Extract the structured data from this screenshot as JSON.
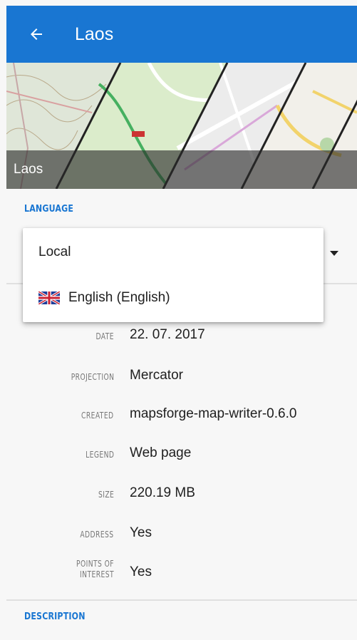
{
  "header": {
    "title": "Laos"
  },
  "map_banner": {
    "caption": "Laos"
  },
  "language_section": {
    "label": "LANGUAGE",
    "options": [
      {
        "label": "Local",
        "flag": ""
      },
      {
        "label": "English (English)",
        "flag": "uk-flag-icon"
      }
    ]
  },
  "details": [
    {
      "label": "DATE",
      "value": "22. 07. 2017"
    },
    {
      "label": "PROJECTION",
      "value": "Mercator"
    },
    {
      "label": "CREATED",
      "value": "mapsforge-map-writer-0.6.0"
    },
    {
      "label": "LEGEND",
      "value": "Web page"
    },
    {
      "label": "SIZE",
      "value": "220.19 MB"
    },
    {
      "label": "ADDRESS",
      "value": "Yes"
    },
    {
      "label": "POINTS OF INTEREST",
      "value": "Yes"
    }
  ],
  "description_section": {
    "label": "DESCRIPTION"
  },
  "colors": {
    "app_bar": "#1976d2",
    "section_label": "#1976d2"
  }
}
